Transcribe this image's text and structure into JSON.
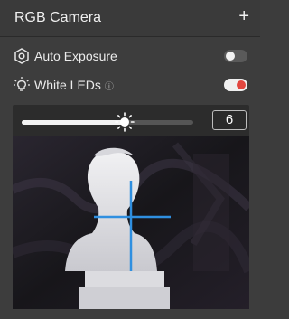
{
  "header": {
    "title": "RGB Camera",
    "add_icon": "plus-icon"
  },
  "settings": {
    "auto_exposure": {
      "label": "Auto Exposure",
      "icon": "exposure-icon",
      "enabled": false
    },
    "white_leds": {
      "label": "White LEDs",
      "icon": "lightbulb-icon",
      "info_icon": "info-icon",
      "enabled": true
    }
  },
  "brightness": {
    "value": "6",
    "slider_fraction": 0.6,
    "handle_icon": "sun-icon"
  },
  "colors": {
    "accent": "#e2463f",
    "crosshair": "#2f8fe0",
    "panel": "#3d3d3d"
  }
}
